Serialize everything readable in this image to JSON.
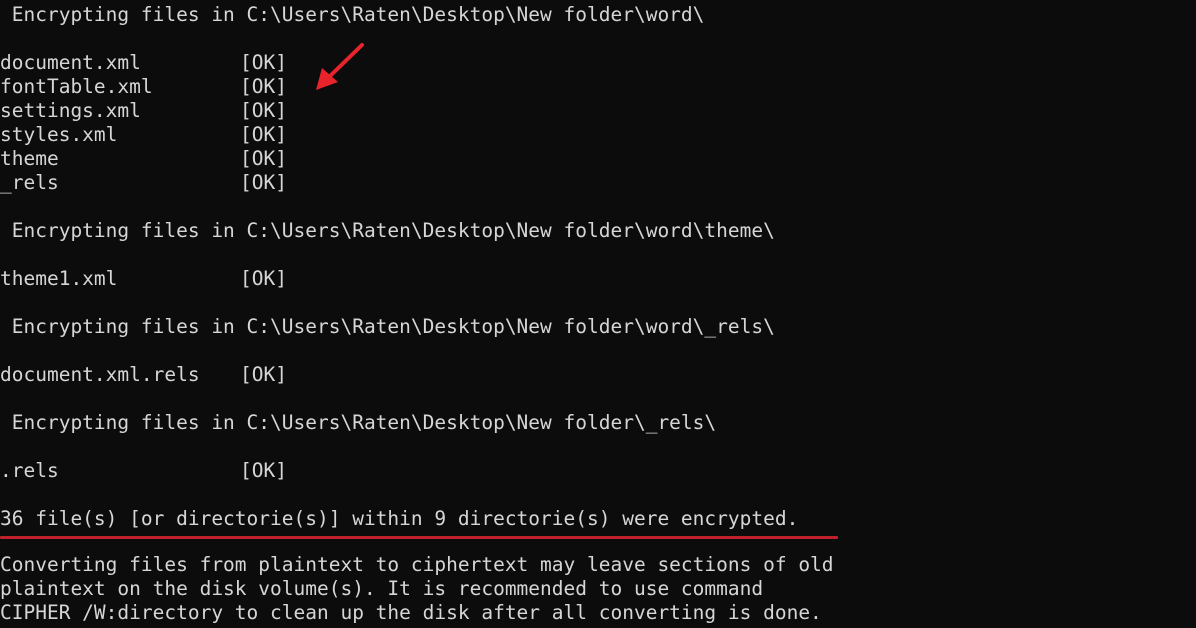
{
  "terminal": {
    "sections": [
      {
        "header": " Encrypting files in C:\\Users\\Raten\\Desktop\\New folder\\word\\",
        "entries": [
          {
            "name": "document.xml",
            "status": "[OK]"
          },
          {
            "name": "fontTable.xml",
            "status": "[OK]"
          },
          {
            "name": "settings.xml",
            "status": "[OK]"
          },
          {
            "name": "styles.xml",
            "status": "[OK]"
          },
          {
            "name": "theme",
            "status": "[OK]"
          },
          {
            "name": "_rels",
            "status": "[OK]"
          }
        ]
      },
      {
        "header": " Encrypting files in C:\\Users\\Raten\\Desktop\\New folder\\word\\theme\\",
        "entries": [
          {
            "name": "theme1.xml",
            "status": "[OK]"
          }
        ]
      },
      {
        "header": " Encrypting files in C:\\Users\\Raten\\Desktop\\New folder\\word\\_rels\\",
        "entries": [
          {
            "name": "document.xml.rels",
            "status": "[OK]"
          }
        ]
      },
      {
        "header": " Encrypting files in C:\\Users\\Raten\\Desktop\\New folder\\_rels\\",
        "entries": [
          {
            "name": ".rels",
            "status": "[OK]"
          }
        ]
      }
    ],
    "summary": "36 file(s) [or directorie(s)] within 9 directorie(s) were encrypted.",
    "notice": [
      "Converting files from plaintext to ciphertext may leave sections of old",
      "plaintext on the disk volume(s). It is recommended to use command",
      "CIPHER /W:directory to clean up the disk after all converting is done."
    ],
    "colors": {
      "background": "#0c0c0c",
      "text": "#d6d6d6",
      "annotation": "#c0212b"
    },
    "annotation_icon": "red-arrow-icon"
  }
}
